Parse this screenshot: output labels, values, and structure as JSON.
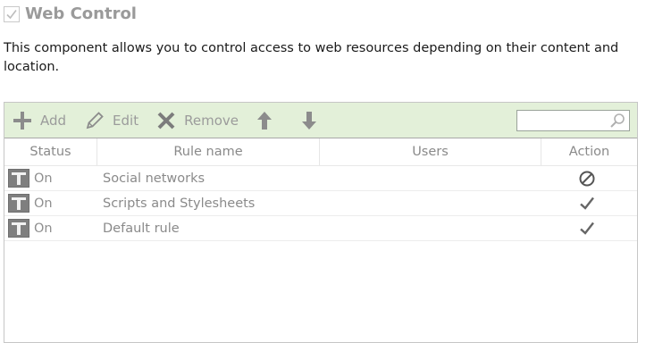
{
  "header": {
    "checked": true,
    "title": "Web Control"
  },
  "description": "This component allows you to control access to web resources depending on their content and location.",
  "toolbar": {
    "add_label": "Add",
    "edit_label": "Edit",
    "remove_label": "Remove",
    "search": {
      "value": "",
      "placeholder": ""
    }
  },
  "table": {
    "columns": [
      "Status",
      "Rule name",
      "Users",
      "Action"
    ],
    "rows": [
      {
        "status": "On",
        "rule_name": "Social networks",
        "users": "",
        "action": "block-icon"
      },
      {
        "status": "On",
        "rule_name": "Scripts and Stylesheets",
        "users": "",
        "action": "checkmark-icon"
      },
      {
        "status": "On",
        "rule_name": "Default rule",
        "users": "",
        "action": "checkmark-icon"
      }
    ]
  },
  "colors": {
    "toolbar_bg": "#e3f0d9",
    "title": "#9a9a9a",
    "toolbar_icons": "#8c8c8c",
    "toggle": "#7f7f7f"
  }
}
